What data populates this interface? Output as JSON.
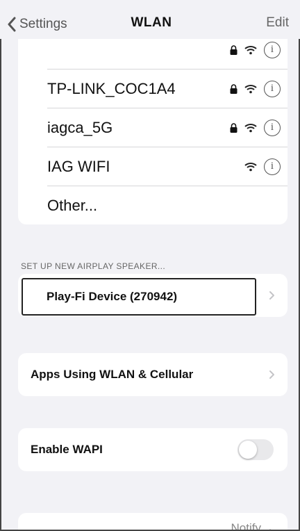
{
  "nav": {
    "back_label": "Settings",
    "title": "WLAN",
    "edit_label": "Edit"
  },
  "networks": [
    {
      "name": "",
      "secured": true,
      "partial": true
    },
    {
      "name": "TP-LINK_COC1A4",
      "secured": true
    },
    {
      "name": "iagca_5G",
      "secured": true
    },
    {
      "name": "IAG WIFI",
      "secured": false
    },
    {
      "name": "Other..."
    }
  ],
  "airplay": {
    "section_header": "SET UP NEW AIRPLAY SPEAKER...",
    "device_label": "Play-Fi Device (270942)"
  },
  "apps_using": {
    "label": "Apps Using WLAN & Cellular"
  },
  "wapi": {
    "label": "Enable WAPI",
    "enabled": false
  },
  "ask_to_join": {
    "value": "Notify"
  },
  "colors": {
    "background": "#f2f2f6",
    "card": "#ffffff",
    "toggle_off": "#e9e9eb",
    "secondary_text": "#888888"
  },
  "icons": [
    "chevron-left-icon",
    "lock-icon",
    "wifi-icon",
    "info-icon",
    "chevron-right-icon"
  ]
}
